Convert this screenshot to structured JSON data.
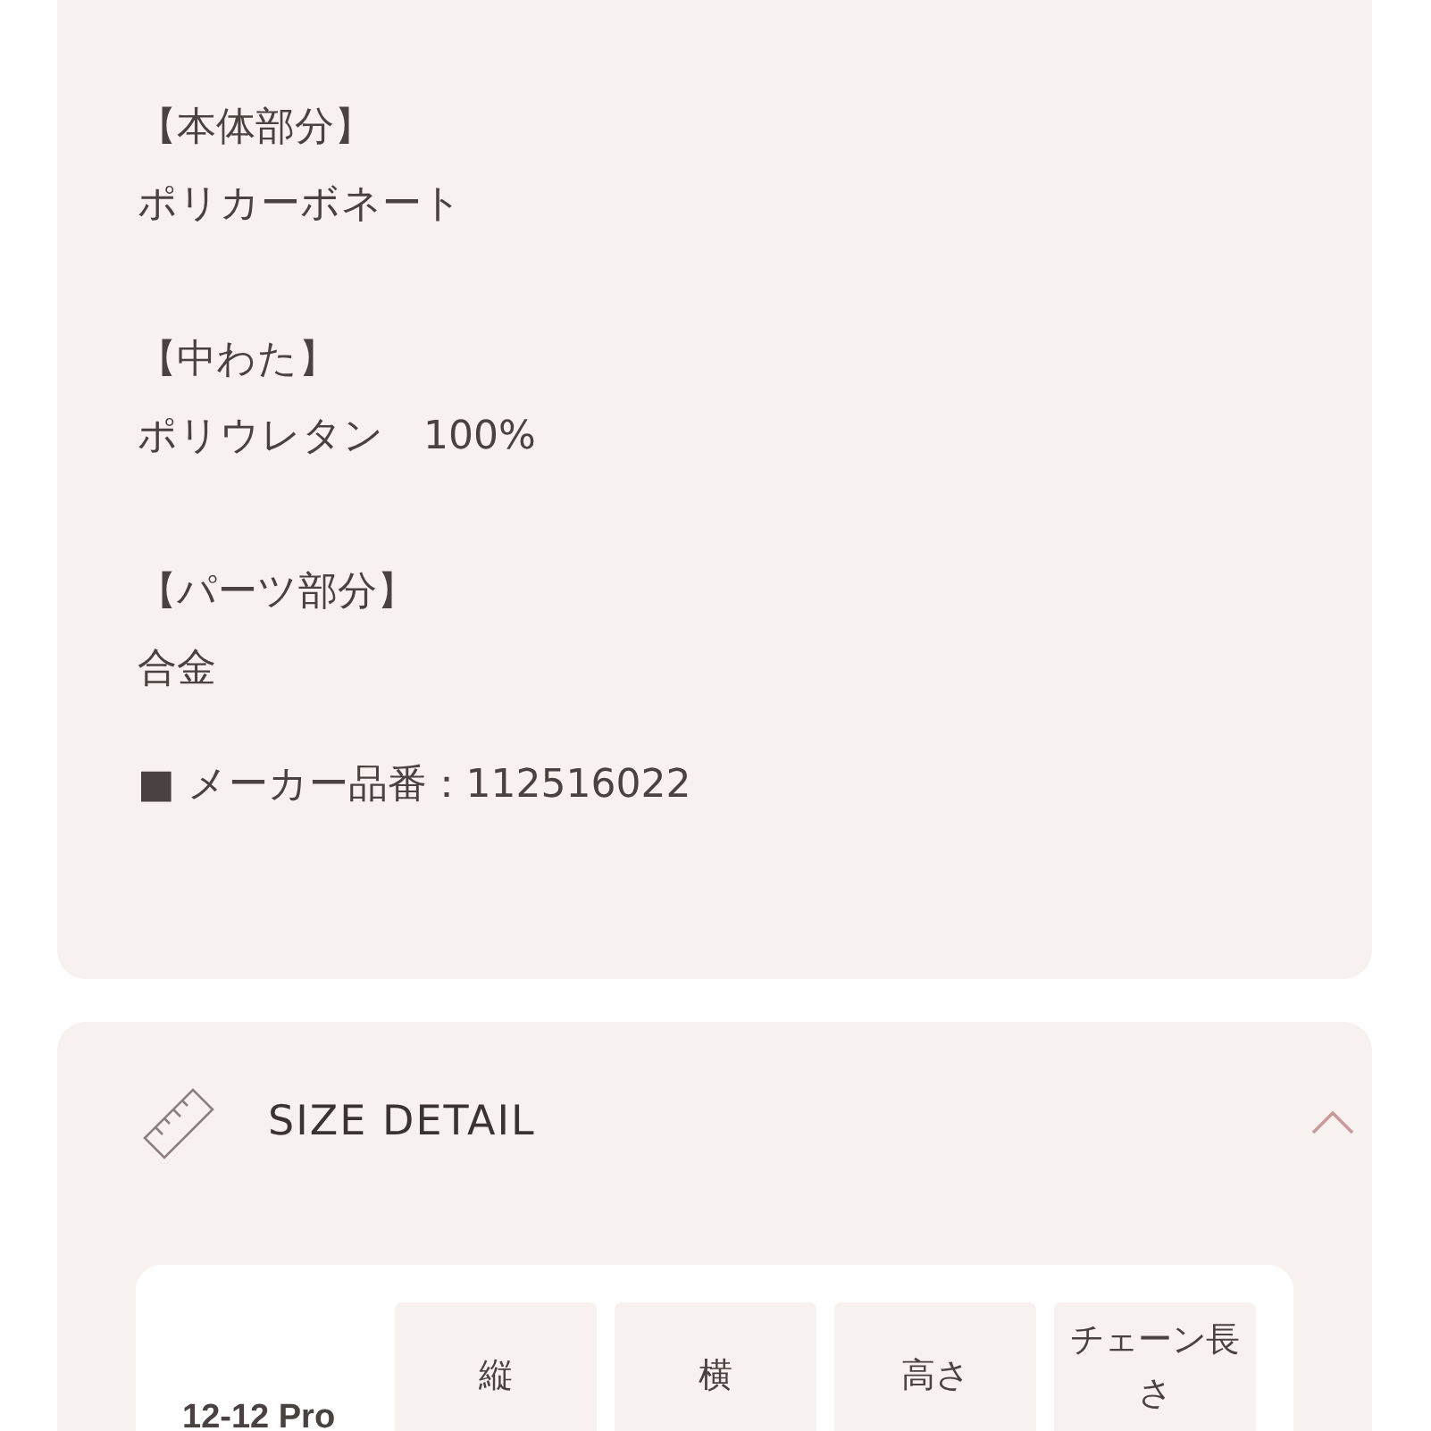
{
  "materials": [
    {
      "heading": "【本体部分】",
      "value": "ポリカーボネート"
    },
    {
      "heading": "【中わた】",
      "value": "ポリウレタン　100%"
    },
    {
      "heading": "【パーツ部分】",
      "value": "合金"
    }
  ],
  "maker_number": "■ メーカー品番：112516022",
  "size_detail": {
    "title": "SIZE DETAIL",
    "expanded": true,
    "table": {
      "columns": [
        "縦",
        "横",
        "高さ",
        "チェーン長さ"
      ],
      "rows": [
        {
          "label": "12-12 Pro"
        }
      ]
    }
  }
}
